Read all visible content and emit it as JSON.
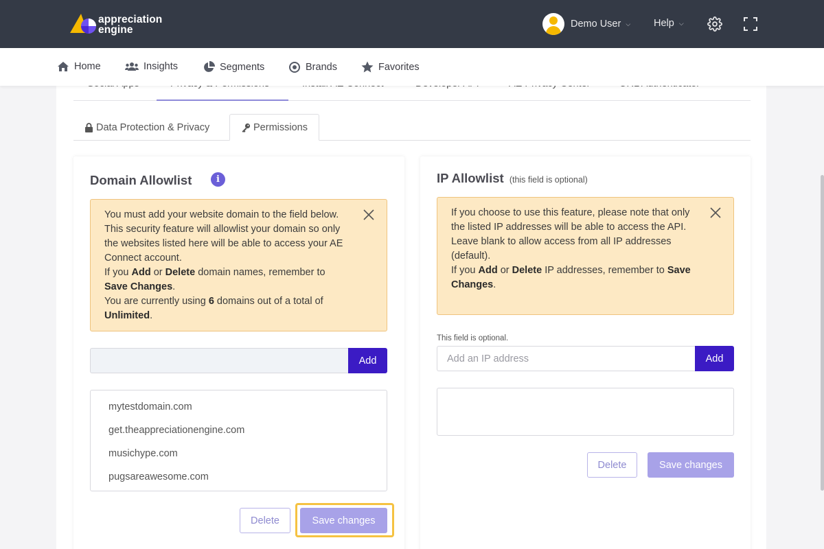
{
  "header": {
    "logo_line1": "appreciation",
    "logo_line2": "engine",
    "user_name": "Demo User",
    "help_label": "Help",
    "icons": {
      "settings": "gear-icon",
      "fullscreen": "expand-icon",
      "caret": "chevron-down-icon"
    }
  },
  "nav": {
    "items": [
      {
        "label": "Home",
        "icon": "home-icon"
      },
      {
        "label": "Insights",
        "icon": "users-icon"
      },
      {
        "label": "Segments",
        "icon": "pie-chart-icon"
      },
      {
        "label": "Brands",
        "icon": "target-icon"
      },
      {
        "label": "Favorites",
        "icon": "star-icon"
      }
    ]
  },
  "top_tabs": [
    {
      "label": "Social Apps"
    },
    {
      "label": "Privacy & Permissions",
      "active": true
    },
    {
      "label": "Install AE Connect"
    },
    {
      "label": "Developer API"
    },
    {
      "label": "AE Privacy Center"
    },
    {
      "label": "URL Authenticator"
    }
  ],
  "sub_tabs": [
    {
      "label": "Data Protection & Privacy",
      "icon": "lock-icon"
    },
    {
      "label": "Permissions",
      "icon": "key-icon",
      "active": true
    }
  ],
  "domain_panel": {
    "title": "Domain Allowlist",
    "alert": {
      "line1": "You must add your website domain to the field below. This security feature will allowlist your domain so only the websites listed here will be able to access your AE Connect account.",
      "line2_pre": "If you ",
      "line2_add": "Add",
      "line2_or": " or ",
      "line2_delete": "Delete",
      "line2_post": " domain names, remember to ",
      "line2_save": "Save Changes",
      "line2_end": ".",
      "line3_pre": "You are currently using ",
      "line3_count": "6",
      "line3_mid": " domains out of a total of ",
      "line3_total": "Unlimited",
      "line3_end": "."
    },
    "input_value": "",
    "add_label": "Add",
    "domains": [
      "mytestdomain.com",
      "get.theappreciationengine.com",
      "musichype.com",
      "pugsareawesome.com"
    ],
    "delete_label": "Delete",
    "save_label": "Save changes"
  },
  "ip_panel": {
    "title": "IP Allowlist",
    "title_note": "(this field is optional)",
    "alert": {
      "line1": "If you choose to use this feature, please note that only the listed IP addresses will be able to access the API.",
      "line2": "Leave blank to allow access from all IP addresses (default).",
      "line3_pre": "If you ",
      "line3_add": "Add",
      "line3_or": " or ",
      "line3_delete": "Delete",
      "line3_post": " IP addresses, remember to ",
      "line3_save": "Save Changes",
      "line3_end": "."
    },
    "optional_label": "This field is optional.",
    "input_placeholder": "Add an IP address",
    "add_label": "Add",
    "delete_label": "Delete",
    "save_label": "Save changes"
  },
  "colors": {
    "header_bg": "#343a46",
    "accent": "#3b1bc4",
    "save_button": "#a8a2e8",
    "alert_bg": "#fde9c4",
    "highlight": "#f5c242"
  }
}
